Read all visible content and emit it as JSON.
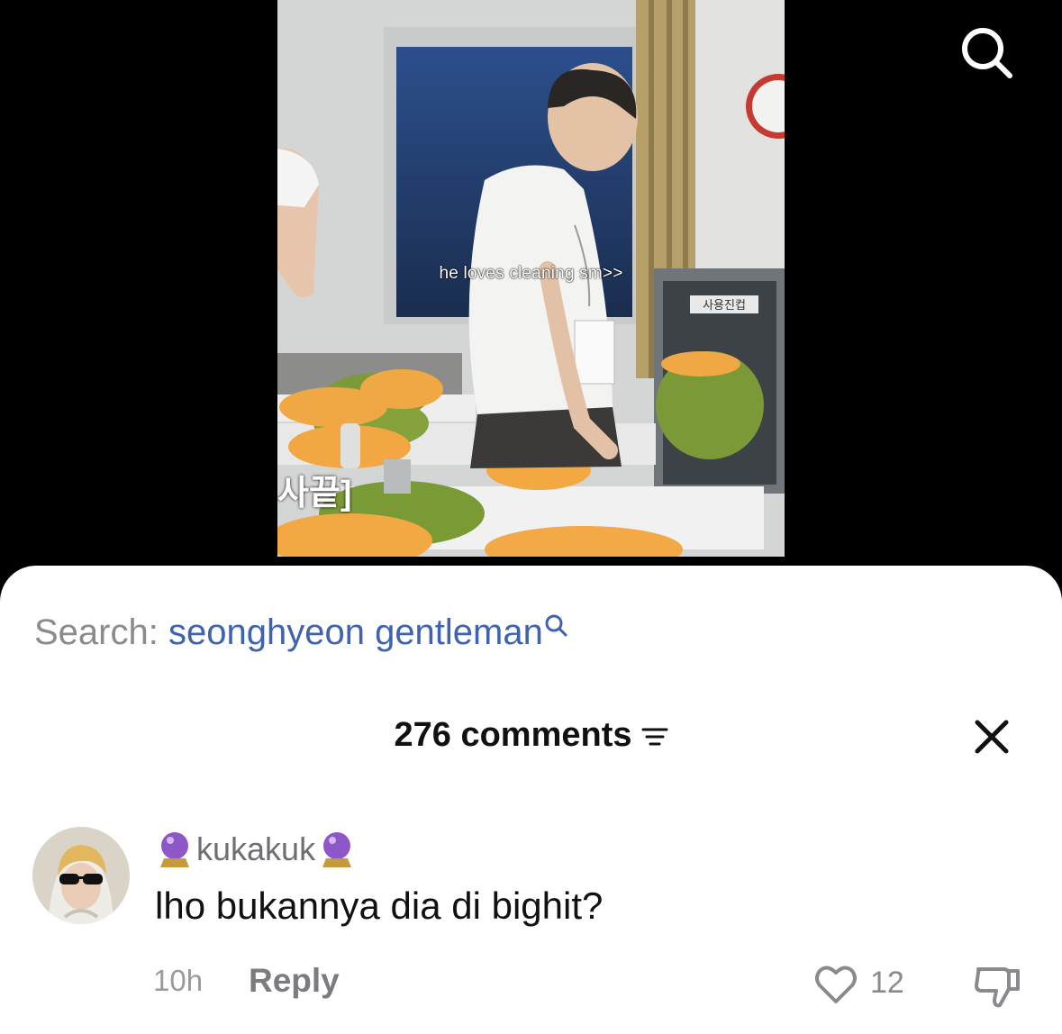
{
  "video": {
    "caption": "he loves cleaning sm>>",
    "sign_text": "사용진컵",
    "subtitle_fragment": "사끝]"
  },
  "top_bar": {
    "search_icon": "search-icon"
  },
  "search_suggestion": {
    "label": "Search:",
    "query": "seonghyeon gentleman",
    "icon": "search-icon"
  },
  "comments": {
    "header": "276 comments",
    "filter_icon": "filter-icon",
    "close_icon": "close-icon",
    "items": [
      {
        "username": "kukakuk",
        "username_decoration": "crystal-ball-emoji",
        "text": "lho bukannya dia di bighit?",
        "time": "10h",
        "reply_label": "Reply",
        "like_count": "12"
      }
    ]
  },
  "colors": {
    "link_blue": "#3f63b0",
    "muted_gray": "#8a8a8f",
    "sheet_bg": "#ffffff",
    "backdrop": "#000000"
  }
}
